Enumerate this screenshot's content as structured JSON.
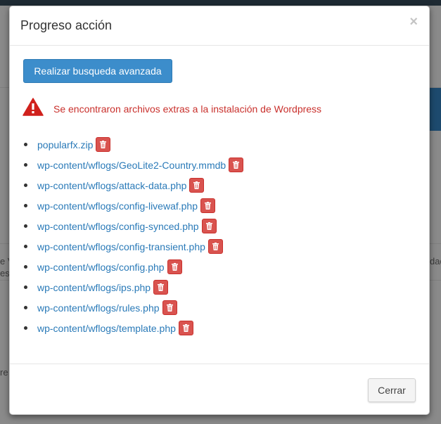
{
  "background": {
    "fragment_left_top": "e V",
    "fragment_left_bottom": "es",
    "fragment_left_lower": "re",
    "fragment_right": "dad"
  },
  "modal": {
    "title": "Progreso acción",
    "close_label": "×",
    "advanced_search_label": "Realizar busqueda avanzada",
    "alert_text": "Se encontraron archivos extras a la instalación de Wordpress",
    "files": [
      "popularfx.zip",
      "wp-content/wflogs/GeoLite2-Country.mmdb",
      "wp-content/wflogs/attack-data.php",
      "wp-content/wflogs/config-livewaf.php",
      "wp-content/wflogs/config-synced.php",
      "wp-content/wflogs/config-transient.php",
      "wp-content/wflogs/config.php",
      "wp-content/wflogs/ips.php",
      "wp-content/wflogs/rules.php",
      "wp-content/wflogs/template.php"
    ],
    "close_button_label": "Cerrar"
  },
  "icons": {
    "alert": "warning-triangle-icon",
    "delete": "trash-icon"
  },
  "colors": {
    "primary": "#3c8dcb",
    "danger": "#d9534f",
    "alert_text": "#c9302c",
    "link": "#2a7ab8"
  }
}
